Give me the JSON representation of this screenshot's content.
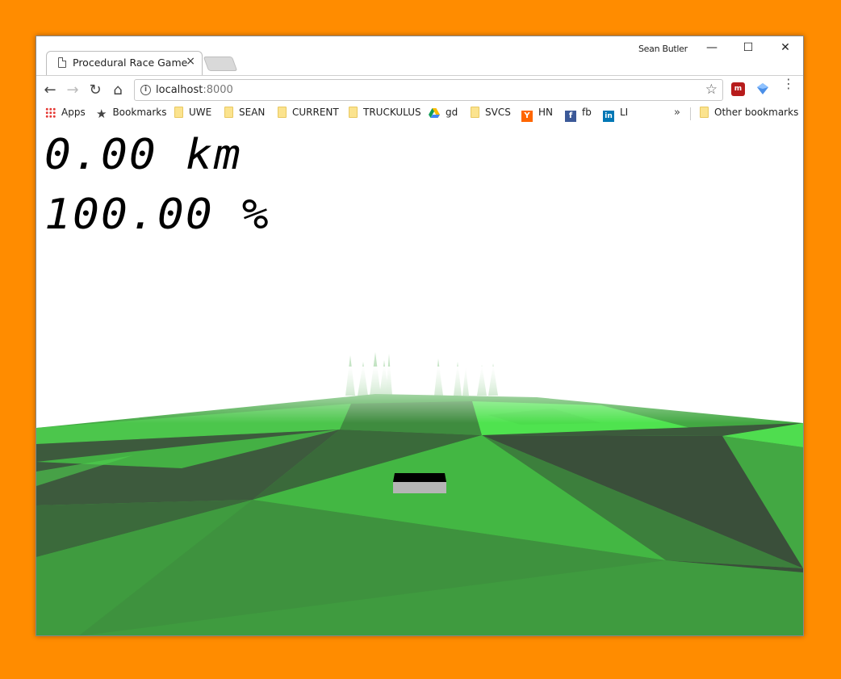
{
  "window": {
    "tab_title": "Procedural Race Game",
    "tab_close": "×",
    "profile_name": "Sean Butler",
    "controls": {
      "minimize": "—",
      "maximize": "☐",
      "close": "✕"
    }
  },
  "toolbar": {
    "back": "←",
    "forward": "→",
    "reload": "↻",
    "home": "⌂",
    "url_host": "localhost",
    "url_port": ":8000",
    "star": "☆",
    "menu": "⋮"
  },
  "bookmarks": {
    "items": [
      {
        "label": "Apps",
        "icon": "apps-grid-icon"
      },
      {
        "label": "Bookmarks",
        "icon": "star-icon"
      },
      {
        "label": "UWE",
        "icon": "folder-icon"
      },
      {
        "label": "SEAN",
        "icon": "folder-icon"
      },
      {
        "label": "CURRENT",
        "icon": "folder-icon"
      },
      {
        "label": "TRUCKULUS",
        "icon": "folder-icon"
      },
      {
        "label": "gd",
        "icon": "google-drive-icon"
      },
      {
        "label": "SVCS",
        "icon": "folder-icon"
      },
      {
        "label": "HN",
        "icon": "hacker-news-icon"
      },
      {
        "label": "fb",
        "icon": "facebook-icon"
      },
      {
        "label": "LI",
        "icon": "linkedin-icon"
      }
    ],
    "more": "»",
    "other": "Other bookmarks"
  },
  "game": {
    "distance": "0.00 km",
    "health": "100.00 %"
  },
  "colors": {
    "background": "#ff8c00",
    "grass_light": "#4fe34f",
    "grass_mid": "#3fa83f",
    "grass_dark": "#3c4a3c",
    "hn_orange": "#ff6600",
    "facebook_blue": "#3b5998",
    "linkedin_blue": "#0077b5"
  }
}
